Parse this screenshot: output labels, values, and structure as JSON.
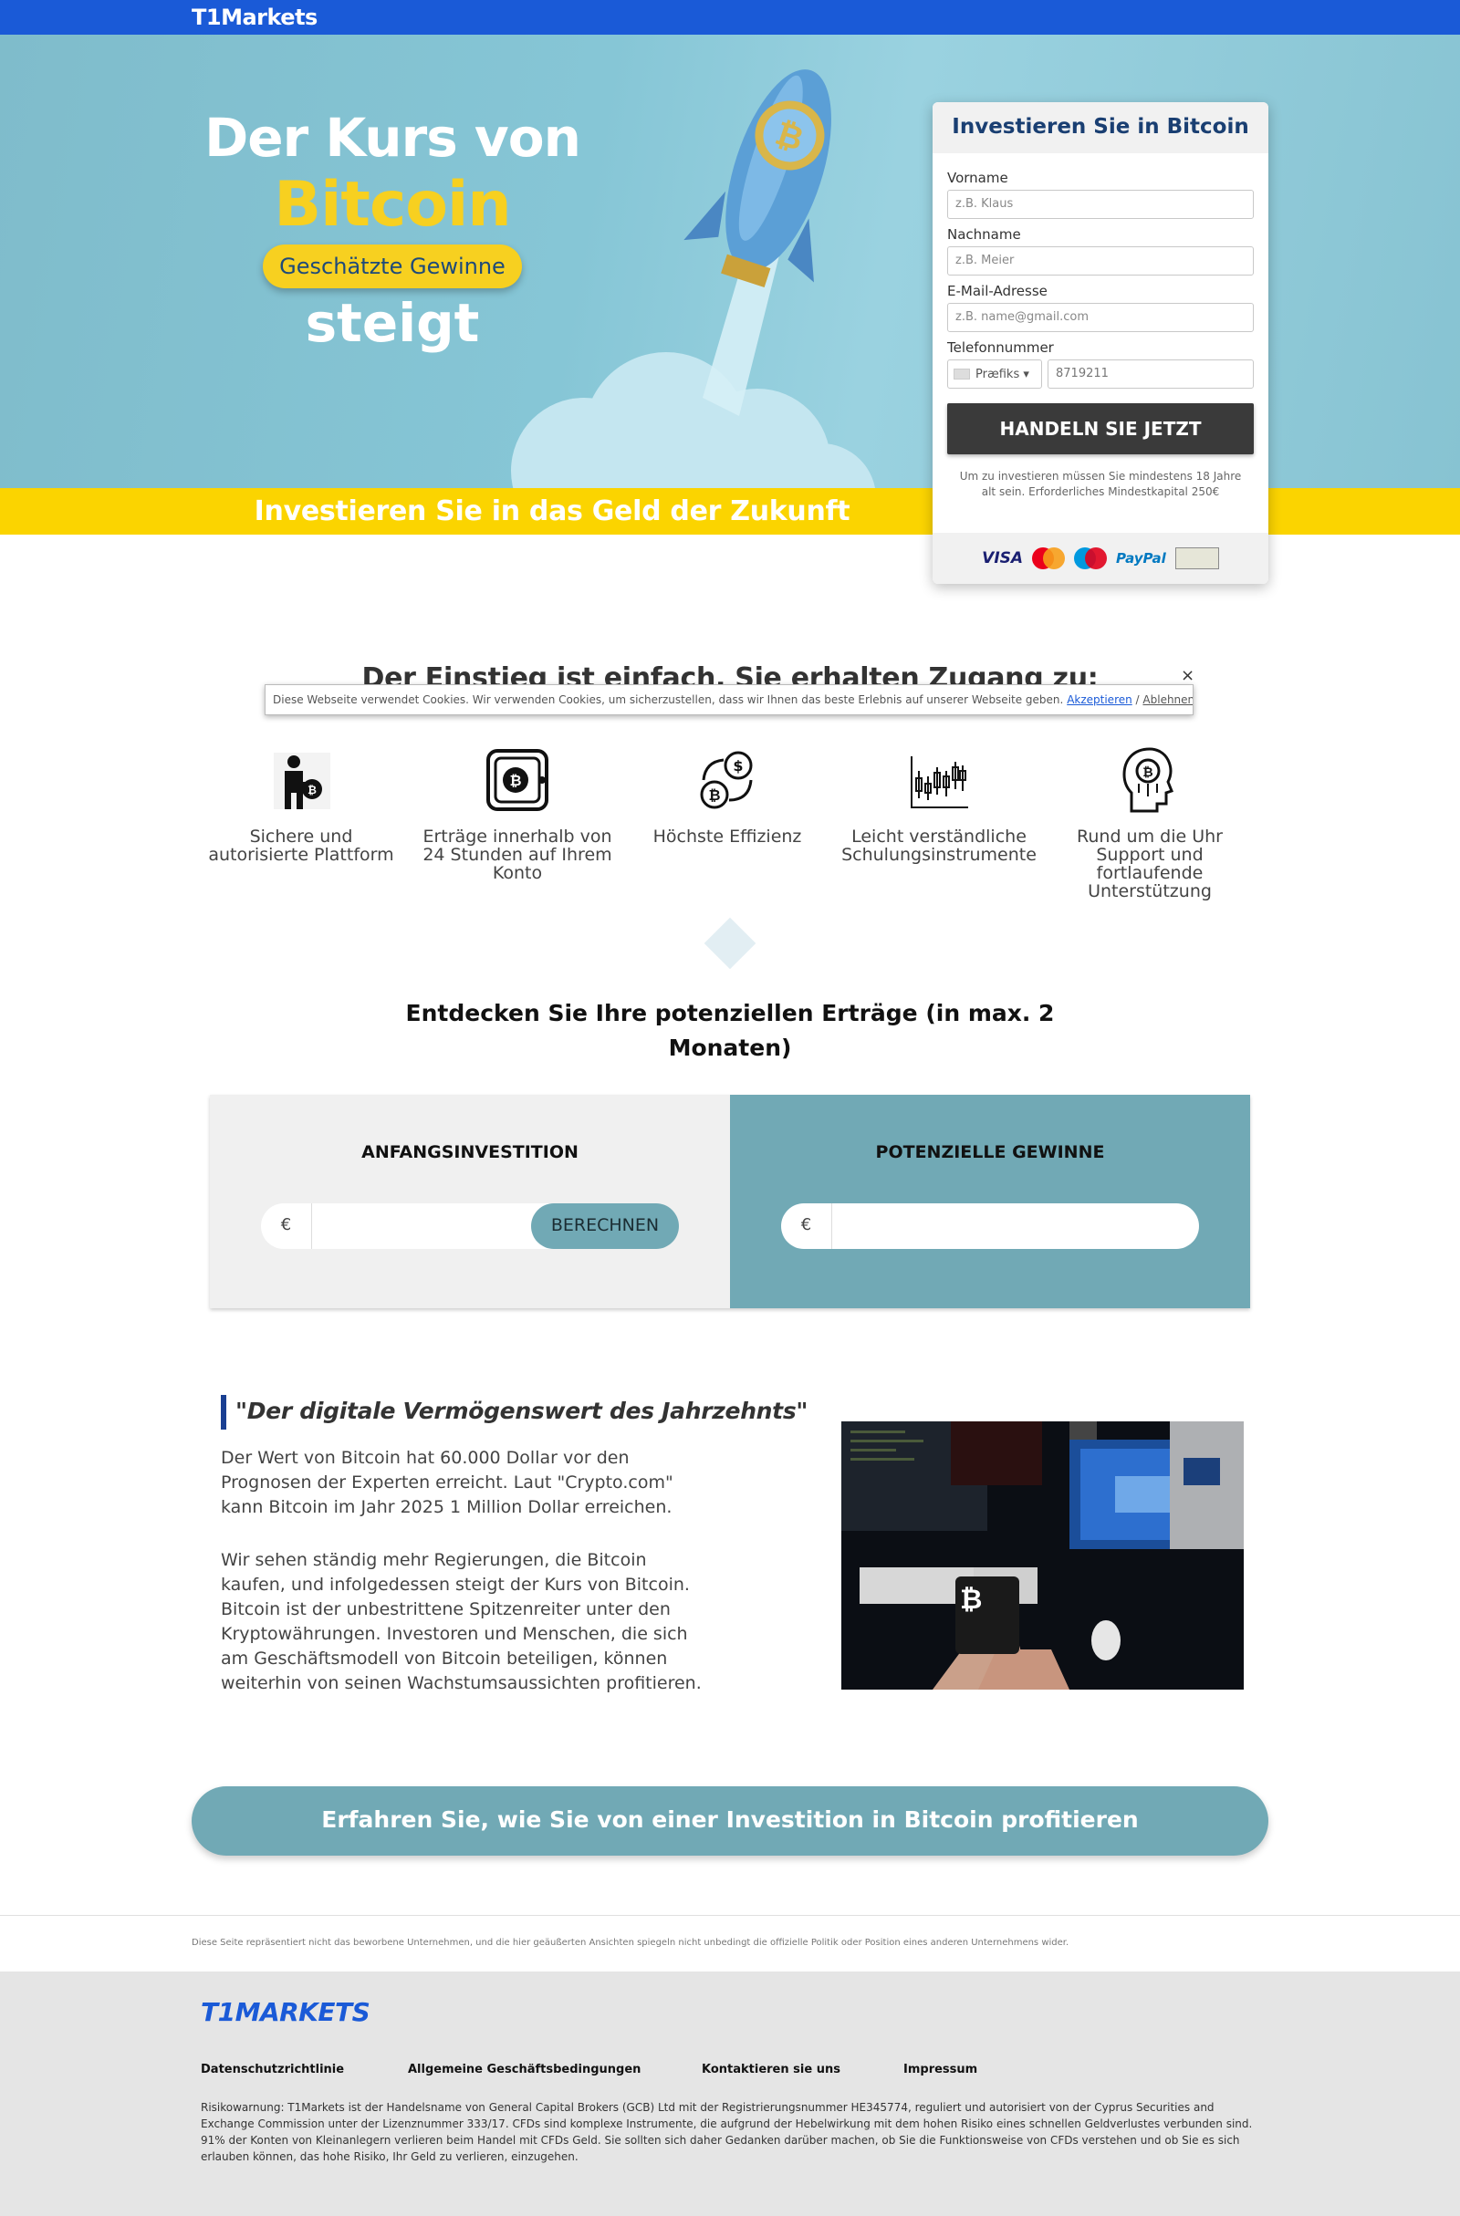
{
  "header": {
    "brand": "T1Markets"
  },
  "hero": {
    "line1": "Der Kurs von",
    "line2": "Bitcoin",
    "badge": "Geschätzte Gewinne",
    "line3": "steigt",
    "band": "Investieren Sie in das Geld der Zukunft"
  },
  "form": {
    "title": "Investieren Sie in Bitcoin",
    "first_name_label": "Vorname",
    "first_name_placeholder": "z.B. Klaus",
    "last_name_label": "Nachname",
    "last_name_placeholder": "z.B. Meier",
    "email_label": "E-Mail-Adresse",
    "email_placeholder": "z.B. name@gmail.com",
    "phone_label": "Telefonnummer",
    "prefix_label": "Præfiks ▾",
    "phone_value": "8719211",
    "submit": "HANDELN SIE JETZT",
    "note": "Um zu investieren müssen Sie mindestens 18 Jahre alt sein. Erforderliches Mindestkapital 250€",
    "payments": {
      "visa": "VISA",
      "paypal": "PayPal"
    }
  },
  "cookie": {
    "close": "×",
    "text": "Diese Webseite verwendet Cookies. Wir verwenden Cookies, um sicherzustellen, dass wir Ihnen das beste Erlebnis auf unserer Webseite geben.",
    "accept": "Akzeptieren",
    "sep": " / ",
    "decline": "Ablehnen"
  },
  "access": {
    "title": "Der Einstieg ist einfach. Sie erhalten Zugang zu:",
    "features": [
      {
        "label": "Sichere und autorisierte Plattform",
        "icon": "person-bitcoin-icon"
      },
      {
        "label": "Erträge innerhalb von 24 Stunden auf Ihrem Konto",
        "icon": "bitcoin-safe-icon"
      },
      {
        "label": "Höchste Effizienz",
        "icon": "exchange-icon"
      },
      {
        "label": "Leicht verständliche Schulungsinstrumente",
        "icon": "candlestick-chart-icon"
      },
      {
        "label": "Rund um die Uhr Support und fortlaufende Unterstützung",
        "icon": "head-bitcoin-icon"
      }
    ]
  },
  "calculator": {
    "title": "Entdecken Sie Ihre potenziellen Erträge (in max. 2 Monaten)",
    "left_head": "ANFANGSINVESTITION",
    "right_head": "POTENZIELLE GEWINNE",
    "currency": "€",
    "button": "BERECHNEN"
  },
  "quote": {
    "title": "\"Der digitale Vermögenswert des Jahrzehnts\"",
    "p1": "Der Wert von Bitcoin hat 60.000 Dollar vor den Prognosen der Experten erreicht. Laut \"Crypto.com\" kann Bitcoin im Jahr 2025 1 Million Dollar erreichen.",
    "p2": "Wir sehen ständig mehr Regierungen, die Bitcoin kaufen, und infolgedessen steigt der Kurs von Bitcoin. Bitcoin ist der unbestrittene Spitzenreiter unter den Kryptowährungen. Investoren und Menschen, die sich am Geschäftsmodell von Bitcoin beteiligen, können weiterhin von seinen Wachstumsaussichten profitieren."
  },
  "cta": {
    "label": "Erfahren Sie, wie Sie von einer Investition in Bitcoin profitieren"
  },
  "disclaimer": "Diese Seite repräsentiert nicht das beworbene Unternehmen, und die hier geäußerten Ansichten spiegeln nicht unbedingt die offizielle Politik oder Position eines anderen Unternehmens wider.",
  "footer": {
    "logo": "T1MARKETS",
    "links": [
      "Datenschutzrichtlinie",
      "Allgemeine Geschäftsbedingungen",
      "Kontaktieren sie uns",
      "Impressum"
    ],
    "risk": "Risikowarnung: T1Markets ist der Handelsname von General Capital Brokers (GCB) Ltd mit der Registrierungsnummer HE345774, reguliert und autorisiert von der Cyprus Securities and Exchange Commission unter der Lizenznummer 333/17. CFDs sind komplexe Instrumente, die aufgrund der Hebelwirkung mit dem hohen Risiko eines schnellen Geldverlustes verbunden sind. 91% der Konten von Kleinanlegern verlieren beim Handel mit CFDs Geld. Sie sollten sich daher Gedanken darüber machen, ob Sie die Funktionsweise von CFDs verstehen und ob Sie es sich erlauben können, das hohe Risiko, Ihr Geld zu verlieren, einzugehen."
  },
  "colors": {
    "brand_blue": "#1a5ad7",
    "yellow": "#fbd400",
    "teal": "#71a9b5",
    "navy": "#1a3f72"
  }
}
